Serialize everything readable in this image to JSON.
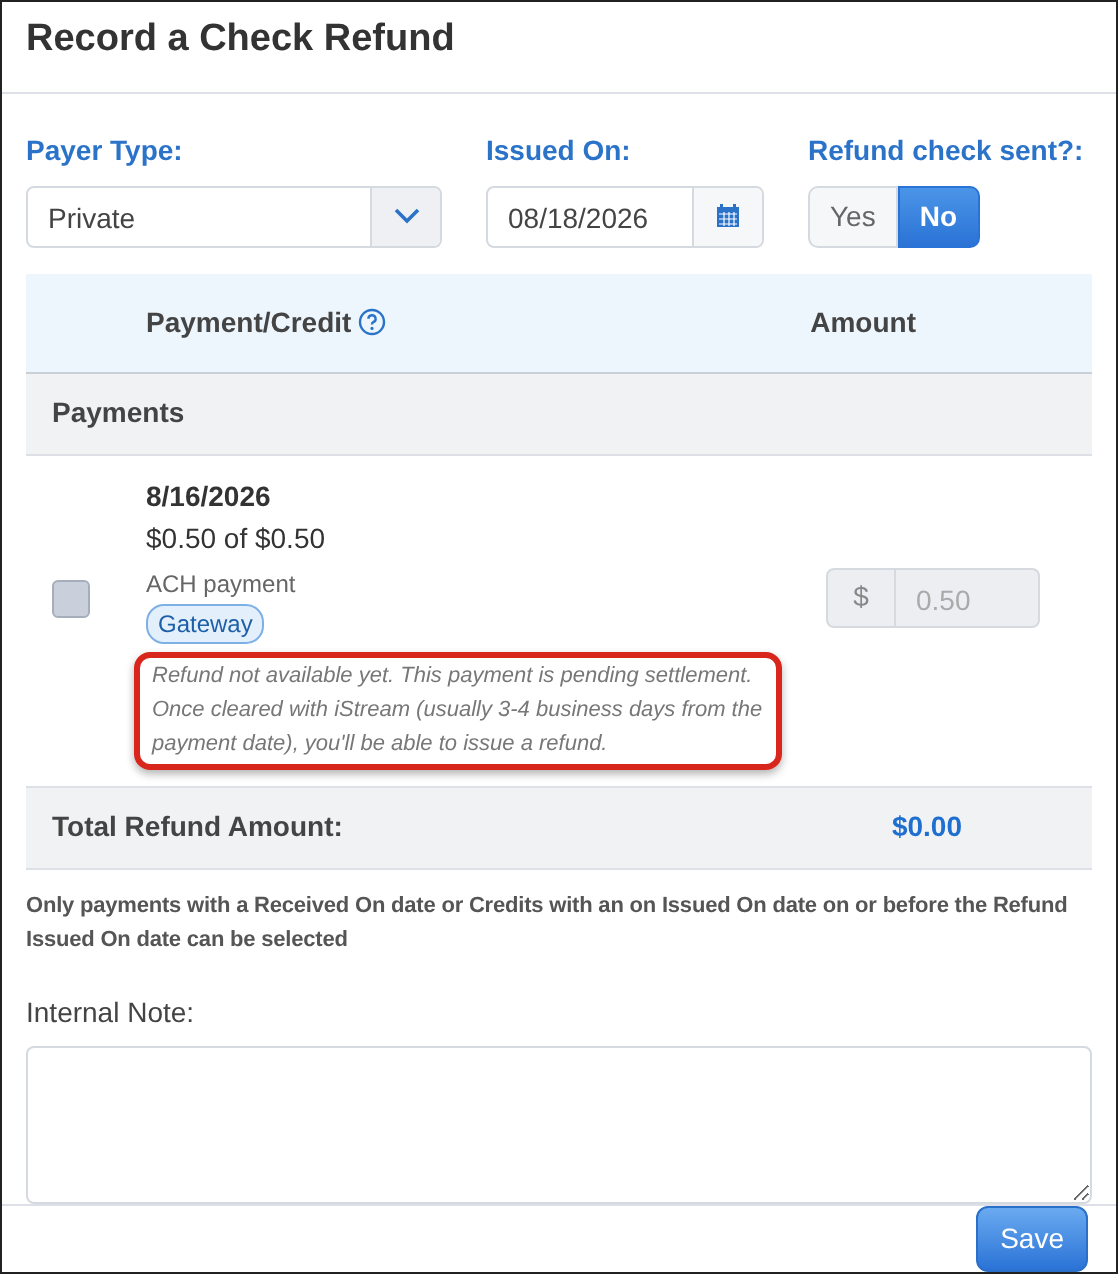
{
  "dialog": {
    "title": "Record a Check Refund"
  },
  "fields": {
    "payer_type": {
      "label": "Payer Type:",
      "value": "Private"
    },
    "issued_on": {
      "label": "Issued On:",
      "value": "08/18/2026"
    },
    "refund_sent": {
      "label": "Refund check sent?:",
      "options": [
        {
          "label": "Yes",
          "selected": false
        },
        {
          "label": "No",
          "selected": true
        }
      ]
    }
  },
  "table": {
    "columns": [
      "Payment/Credit",
      "Amount"
    ],
    "group": "Payments",
    "rows": [
      {
        "checked": false,
        "date": "8/16/2026",
        "amount_line": "$0.50 of $0.50",
        "method": "ACH payment",
        "tag": "Gateway",
        "note": "Refund not available yet. This payment is pending settlement. Once cleared with iStream (usually 3-4 business days from the payment date), you'll be able to issue a refund.",
        "note_highlighted": true,
        "currency": "$",
        "amount": "0.50",
        "disabled": true
      }
    ],
    "total_label": "Total Refund Amount:",
    "total_value": "$0.00"
  },
  "hint": "Only payments with a Received On date or Credits with an on Issued On date on or before the Refund Issued On date can be selected",
  "internal_note": {
    "label": "Internal Note:"
  },
  "buttons": [
    {
      "label": "Save"
    }
  ]
}
